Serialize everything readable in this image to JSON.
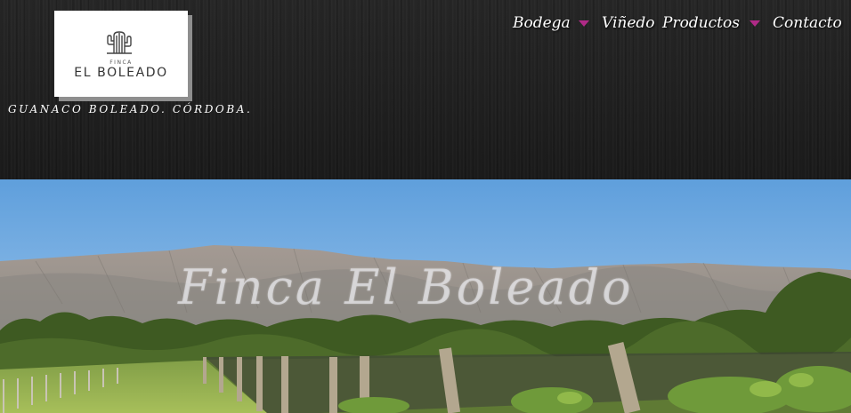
{
  "logo": {
    "small_text": "FINCA",
    "name": "EL BOLEADO",
    "icon": "cactus-icon"
  },
  "tagline": "GUANACO BOLEADO. CÓRDOBA.",
  "nav": {
    "items": [
      {
        "label": "Bodega",
        "has_dropdown": true
      },
      {
        "label": "Viñedo",
        "has_dropdown": false
      },
      {
        "label": "Productos",
        "has_dropdown": true
      },
      {
        "label": "Contacto",
        "has_dropdown": false
      }
    ],
    "caret_icon": "caret-down-icon",
    "caret_color": "#b02a87"
  },
  "hero": {
    "title": "Finca  El Boleado"
  },
  "colors": {
    "header_bg": "#1f1f1f",
    "sky": "#6ea7dc",
    "nav_text": "#ffffff"
  }
}
